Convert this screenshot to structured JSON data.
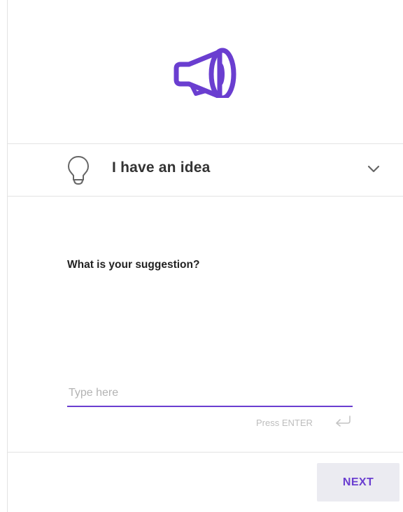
{
  "theme": {
    "accent": "#6a3ed0",
    "text": "#222222",
    "muted": "#bdbdbd",
    "button_bg": "#ebebf1"
  },
  "header": {
    "icon": "megaphone-icon"
  },
  "category": {
    "icon": "lightbulb-icon",
    "label": "I have an idea",
    "expand_icon": "chevron-down-icon"
  },
  "form": {
    "question": "What is your suggestion?",
    "input_value": "",
    "placeholder": "Type here",
    "hint": "Press ENTER",
    "hint_icon": "enter-return-icon"
  },
  "footer": {
    "next_label": "NEXT"
  }
}
